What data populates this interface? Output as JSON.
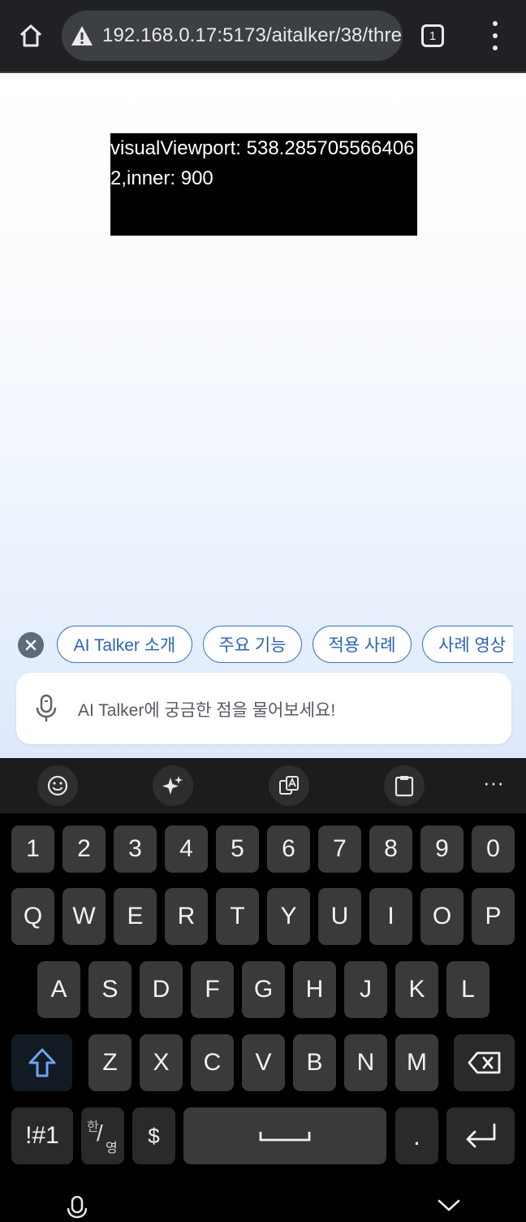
{
  "browser": {
    "url": "192.168.0.17:5173/aitalker/38/thre",
    "tab_count": "1"
  },
  "page": {
    "debug_text": "visualViewport: 538.2857055664062,inner: 900",
    "chips": [
      "AI Talker 소개",
      "주요 기능",
      "적용 사례",
      "사례 영상"
    ],
    "input_placeholder": "AI Talker에 궁금한 점을 물어보세요!"
  },
  "keyboard": {
    "number_row": [
      "1",
      "2",
      "3",
      "4",
      "5",
      "6",
      "7",
      "8",
      "9",
      "0"
    ],
    "row1": [
      "Q",
      "W",
      "E",
      "R",
      "T",
      "Y",
      "U",
      "I",
      "O",
      "P"
    ],
    "row2": [
      "A",
      "S",
      "D",
      "F",
      "G",
      "H",
      "J",
      "K",
      "L"
    ],
    "row3": [
      "Z",
      "X",
      "C",
      "V",
      "B",
      "N",
      "M"
    ],
    "symbols_label": "!#1",
    "lang_top": "한",
    "lang_bottom": "영",
    "currency": "$",
    "period": "."
  },
  "colors": {
    "chip_border": "#3a75c4",
    "chip_text": "#2a63b5",
    "key_bg": "#3a3a3c"
  }
}
